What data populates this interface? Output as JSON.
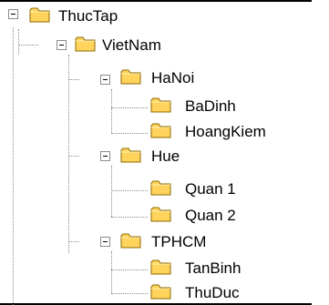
{
  "tree": {
    "root": {
      "label": "ThucTap",
      "expanded": true,
      "children": [
        {
          "label": "VietNam",
          "expanded": true,
          "children": [
            {
              "label": "HaNoi",
              "expanded": true,
              "children": [
                {
                  "label": "BaDinh"
                },
                {
                  "label": "HoangKiem"
                }
              ]
            },
            {
              "label": "Hue",
              "expanded": true,
              "children": [
                {
                  "label": "Quan 1"
                },
                {
                  "label": "Quan 2"
                }
              ]
            },
            {
              "label": "TPHCM",
              "expanded": true,
              "children": [
                {
                  "label": "TanBinh"
                },
                {
                  "label": "ThuDuc"
                }
              ]
            }
          ]
        }
      ]
    }
  },
  "colors": {
    "folder_fill": "#ffd35c",
    "folder_edge": "#8c6a00",
    "tree_line": "#8a8a8a",
    "border": "#000000"
  },
  "icons": {
    "collapse": "minus-box-icon",
    "folder": "folder-icon"
  }
}
